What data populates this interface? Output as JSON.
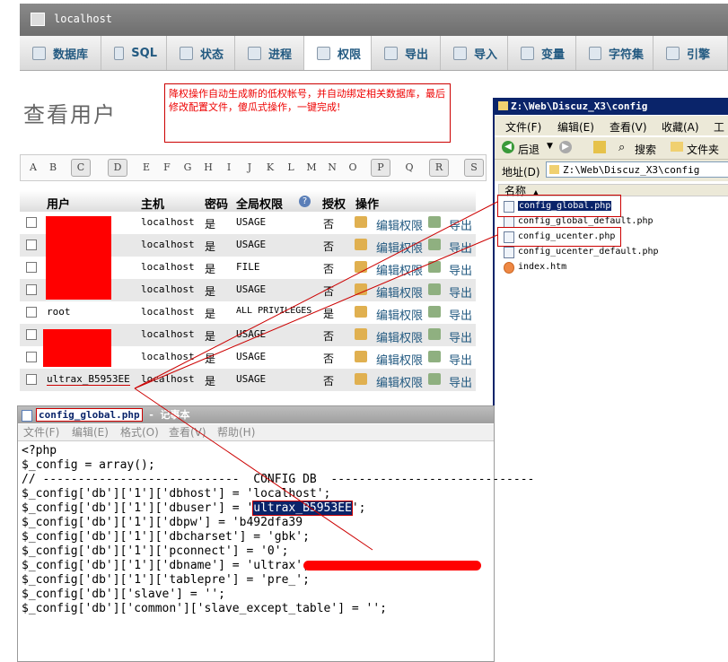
{
  "window": {
    "title": "localhost"
  },
  "tabs": [
    {
      "label": "数据库"
    },
    {
      "label": "SQL"
    },
    {
      "label": "状态"
    },
    {
      "label": "进程"
    },
    {
      "label": "权限"
    },
    {
      "label": "导出"
    },
    {
      "label": "导入"
    },
    {
      "label": "变量"
    },
    {
      "label": "字符集"
    },
    {
      "label": "引擎"
    }
  ],
  "page": {
    "title": "查看用户"
  },
  "annotation": {
    "text": "降权操作自动生成新的低权帐号，并自动绑定相关数据库，最后修改配置文件，傻瓜式操作，一键完成!"
  },
  "letters": [
    "A",
    "B",
    "C",
    "D",
    "E",
    "F",
    "G",
    "H",
    "I",
    "J",
    "K",
    "L",
    "M",
    "N",
    "O",
    "P",
    "Q",
    "R",
    "S"
  ],
  "table": {
    "headers": {
      "user": "用户",
      "host": "主机",
      "password": "密码",
      "global_priv": "全局权限",
      "grant": "授权",
      "action": "操作"
    },
    "edit_label": "编辑权限",
    "export_label": "导出",
    "rows": [
      {
        "user": "",
        "host": "localhost",
        "password": "是",
        "priv": "USAGE",
        "grant": "否"
      },
      {
        "user": "",
        "host": "localhost",
        "password": "是",
        "priv": "USAGE",
        "grant": "否"
      },
      {
        "user": "",
        "host": "localhost",
        "password": "是",
        "priv": "FILE",
        "grant": "否"
      },
      {
        "user": "",
        "host": "localhost",
        "password": "是",
        "priv": "USAGE",
        "grant": "否"
      },
      {
        "user": "root",
        "host": "localhost",
        "password": "是",
        "priv": "ALL PRIVILEGES",
        "grant": "是"
      },
      {
        "user": "",
        "host": "localhost",
        "password": "是",
        "priv": "USAGE",
        "grant": "否"
      },
      {
        "user": "",
        "host": "localhost",
        "password": "是",
        "priv": "USAGE",
        "grant": "否"
      },
      {
        "user": "ultrax_B5953EE",
        "host": "localhost",
        "password": "是",
        "priv": "USAGE",
        "grant": "否"
      }
    ]
  },
  "explorer": {
    "title": "Z:\\Web\\Discuz_X3\\config",
    "menu": [
      "文件(F)",
      "编辑(E)",
      "查看(V)",
      "收藏(A)",
      "工"
    ],
    "toolbar": {
      "back": "后退",
      "search": "搜索",
      "folders": "文件夹"
    },
    "address_label": "地址(D)",
    "address": "Z:\\Web\\Discuz_X3\\config",
    "column_name": "名称",
    "files": [
      "config_global.php",
      "config_global_default.php",
      "config_ucenter.php",
      "config_ucenter_default.php",
      "index.htm"
    ]
  },
  "notepad": {
    "title_file": "config_global.php",
    "title_app": " - 记事本",
    "menu": [
      "文件(F)",
      "编辑(E)",
      "格式(O)",
      "查看(V)",
      "帮助(H)"
    ],
    "lines": [
      "<?php",
      "",
      "",
      "$_config = array();",
      "",
      "// ----------------------------  CONFIG DB  -----------------------------",
      "$_config['db']['1']['dbhost'] = 'localhost';",
      "$_config['db']['1']['dbuser'] = 'ultrax_B5953EE';",
      "$_config['db']['1']['dbpw'] = 'b492dfa39",
      "$_config['db']['1']['dbcharset'] = 'gbk';",
      "$_config['db']['1']['pconnect'] = '0';",
      "$_config['db']['1']['dbname'] = 'ultrax';",
      "$_config['db']['1']['tablepre'] = 'pre_';",
      "$_config['db']['slave'] = '';",
      "$_config['db']['common']['slave_except_table'] = '';"
    ]
  }
}
